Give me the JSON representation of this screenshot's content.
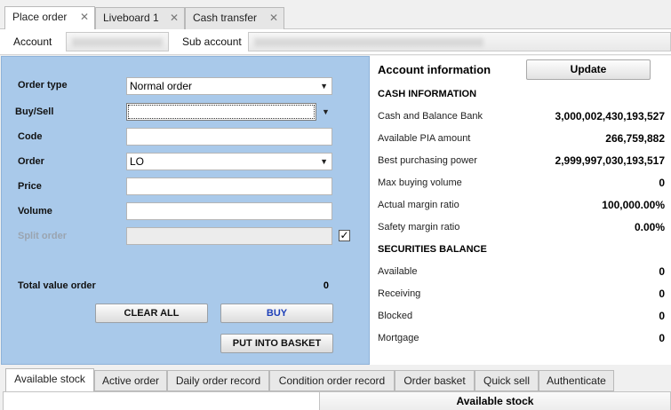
{
  "top_tabs": [
    {
      "label": "Place order",
      "active": true
    },
    {
      "label": "Liveboard 1",
      "active": false
    },
    {
      "label": "Cash transfer",
      "active": false
    }
  ],
  "close_glyph": "✕",
  "account_row": {
    "account_label": "Account",
    "sub_account_label": "Sub account"
  },
  "order_form": {
    "order_type_label": "Order type",
    "order_type_value": "Normal order",
    "buy_sell_label": "Buy/Sell",
    "buy_sell_value": "",
    "code_label": "Code",
    "code_value": "",
    "order_label": "Order",
    "order_value": "LO",
    "price_label": "Price",
    "price_value": "",
    "volume_label": "Volume",
    "volume_value": "",
    "split_order_label": "Split order",
    "split_order_checked": true,
    "check_glyph": "✓",
    "caret_glyph": "▼",
    "total_label": "Total value order",
    "total_value": "0",
    "clear_all_label": "CLEAR ALL",
    "buy_label": "BUY",
    "basket_label": "PUT INTO BASKET"
  },
  "account_info": {
    "title": "Account information",
    "update_label": "Update",
    "cash_header": "CASH INFORMATION",
    "cash_rows": [
      {
        "label": "Cash and Balance Bank",
        "value": "3,000,002,430,193,527"
      },
      {
        "label": "Available PIA amount",
        "value": "266,759,882"
      },
      {
        "label": "Best purchasing power",
        "value": "2,999,997,030,193,517"
      },
      {
        "label": "Max buying volume",
        "value": "0"
      },
      {
        "label": "Actual margin ratio",
        "value": "100,000.00%"
      },
      {
        "label": "Safety margin ratio",
        "value": "0.00%"
      }
    ],
    "securities_header": "SECURITIES BALANCE",
    "securities_rows": [
      {
        "label": "Available",
        "value": "0"
      },
      {
        "label": "Receiving",
        "value": "0"
      },
      {
        "label": "Blocked",
        "value": "0"
      },
      {
        "label": "Mortgage",
        "value": "0"
      }
    ]
  },
  "bottom_tabs": [
    {
      "label": "Available stock",
      "active": true
    },
    {
      "label": "Active order",
      "active": false
    },
    {
      "label": "Daily order record",
      "active": false
    },
    {
      "label": "Condition order record",
      "active": false
    },
    {
      "label": "Order basket",
      "active": false
    },
    {
      "label": "Quick sell",
      "active": false
    },
    {
      "label": "Authenticate",
      "active": false
    }
  ],
  "bottom_content": {
    "column_header": "Available stock"
  },
  "colors": {
    "panel_blue": "#a9c9ea",
    "buy_text": "#1d3fb8"
  }
}
